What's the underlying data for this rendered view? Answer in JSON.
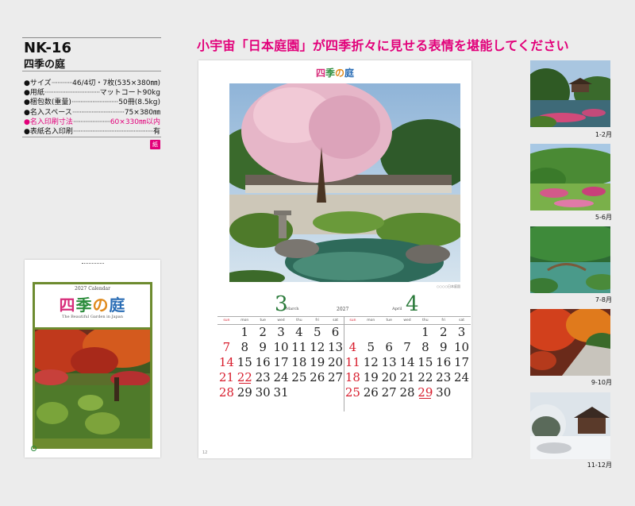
{
  "product": {
    "code": "NK-16",
    "name": "四季の庭"
  },
  "specs": [
    {
      "label": "●サイズ",
      "value": "46/4切・7枚(535×380㎜)",
      "highlight": false
    },
    {
      "label": "●用紙",
      "value": "マットコート90kg",
      "highlight": false
    },
    {
      "label": "●梱包数(重量)",
      "value": "50冊(8.5kg)",
      "highlight": false
    },
    {
      "label": "●名入スペース",
      "value": "75×380㎜",
      "highlight": false
    },
    {
      "label": "●名入印刷寸法",
      "value": "60×330㎜以内",
      "highlight": true
    },
    {
      "label": "●表紙名入印刷",
      "value": "有",
      "highlight": false
    }
  ],
  "badge": "紙",
  "headline": "小宇宙「日本庭園」が四季折々に見せる表情を堪能してください",
  "cover": {
    "year": "2027 Calendar",
    "title_chars": [
      "四",
      "季",
      "の",
      "庭"
    ],
    "subtitle": "The Beautiful Garden in Japan"
  },
  "calendar_page": {
    "title_chars": [
      "四",
      "季",
      "の",
      "庭"
    ],
    "photo_credit": "○○○○日本庭園",
    "page_number": "12",
    "year": "2027",
    "weekdays": [
      "sun",
      "mon",
      "tue",
      "wed",
      "thu",
      "fri",
      "sat"
    ],
    "months": [
      {
        "number": "3",
        "name": "March",
        "start": 1,
        "days": [
          "1",
          "2",
          "3",
          "4",
          "5",
          "6",
          "7",
          "8",
          "9",
          "10",
          "11",
          "12",
          "13",
          "14",
          "15",
          "16",
          "17",
          "18",
          "19",
          "20",
          "21",
          "22",
          "23",
          "24",
          "25",
          "26",
          "27",
          "28",
          "29",
          "30",
          "31"
        ],
        "holidays": [
          "22"
        ]
      },
      {
        "number": "4",
        "name": "April",
        "start": 4,
        "days": [
          "1",
          "2",
          "3",
          "4",
          "5",
          "6",
          "7",
          "8",
          "9",
          "10",
          "11",
          "12",
          "13",
          "14",
          "15",
          "16",
          "17",
          "18",
          "19",
          "20",
          "21",
          "22",
          "23",
          "24",
          "25",
          "26",
          "27",
          "28",
          "29",
          "30"
        ],
        "holidays": [
          "29"
        ]
      }
    ]
  },
  "thumbnails": [
    {
      "label": "1-2月"
    },
    {
      "label": "5-6月"
    },
    {
      "label": "7-8月"
    },
    {
      "label": "9-10月"
    },
    {
      "label": "11-12月"
    }
  ],
  "colors": {
    "accent": "#e2007a",
    "sunday": "#d81d2d",
    "month_number": "#2a7a3a"
  }
}
